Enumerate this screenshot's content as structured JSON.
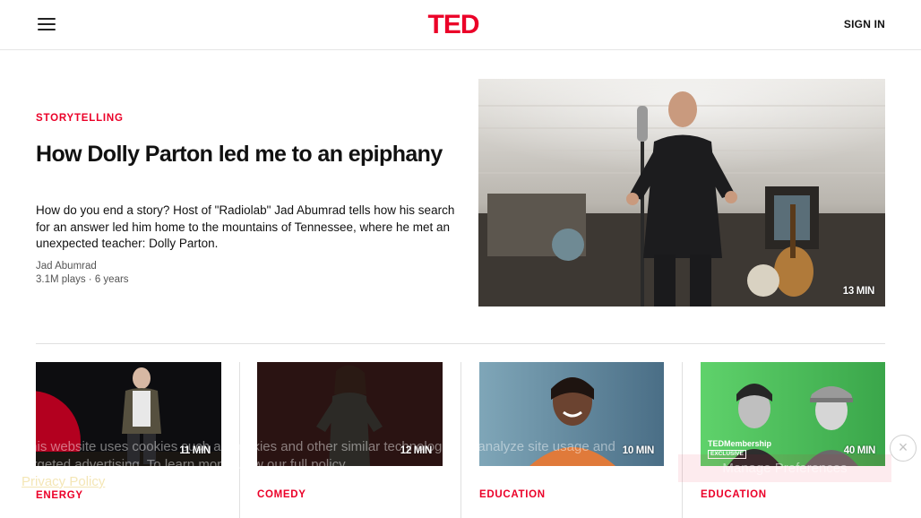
{
  "header": {
    "logo": "TED",
    "signin_label": "SIGN IN"
  },
  "featured": {
    "category": "STORYTELLING",
    "title": "How Dolly Parton led me to an epiphany",
    "description": "How do you end a story? Host of \"Radiolab\" Jad Abumrad tells how his search for an answer led him home to the mountains of Tennessee, where he met an unexpected teacher: Dolly Parton.",
    "speaker": "Jad Abumrad",
    "meta": "3.1M plays · 6 years",
    "duration": "13 MIN"
  },
  "cards": [
    {
      "category": "ENERGY",
      "duration": "11 MIN"
    },
    {
      "category": "COMEDY",
      "duration": "12 MIN"
    },
    {
      "category": "EDUCATION",
      "duration": "10 MIN"
    },
    {
      "category": "EDUCATION",
      "duration": "40 MIN",
      "badge_brand": "TEDMembership",
      "badge_label": "EXCLUSIVE"
    }
  ],
  "cookie": {
    "text": "This website uses cookies such as cookies and other similar technologies to analyze site usage and targeted advertising. To learn more, view our full policy.",
    "privacy_link": "Privacy Policy",
    "button_label": "Manage Preferences",
    "close_glyph": "×"
  },
  "colors": {
    "brand_red": "#eb0028",
    "text": "#111111",
    "muted": "#555555"
  },
  "icons": {
    "menu": "hamburger-menu-icon",
    "close": "close-icon"
  }
}
